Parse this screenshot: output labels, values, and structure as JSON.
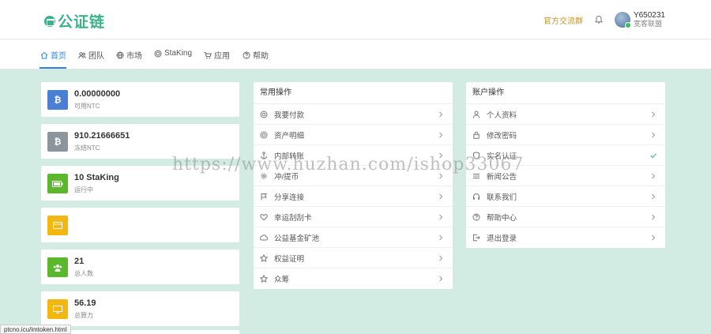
{
  "header": {
    "logo_text": "公证链",
    "community_link": "官方交流群",
    "user_name": "Y650231",
    "user_role": "宽客联盟",
    "brand_color": "#3bb28a"
  },
  "nav": {
    "items": [
      {
        "label": "首页",
        "icon": "home-icon",
        "active": true
      },
      {
        "label": "团队",
        "icon": "users-icon",
        "active": false
      },
      {
        "label": "市场",
        "icon": "globe-icon",
        "active": false
      },
      {
        "label": "StaKing",
        "icon": "coin-icon",
        "active": false
      },
      {
        "label": "应用",
        "icon": "cart-icon",
        "active": false
      },
      {
        "label": "帮助",
        "icon": "help-icon",
        "active": false
      }
    ]
  },
  "stats": [
    {
      "value": "0.00000000",
      "label": "可用NTC",
      "color": "#4a7fd4",
      "icon": "bitcoin-icon",
      "glyph": "₿"
    },
    {
      "value": "910.21666651",
      "label": "冻结NTC",
      "color": "#8d959c",
      "icon": "bitcoin-icon",
      "glyph": "₿"
    },
    {
      "value": "10 StaKing",
      "label": "运行中",
      "color": "#5bb82c",
      "icon": "battery-icon",
      "glyph": ""
    },
    {
      "value": "",
      "label": "",
      "color": "#f2b710",
      "icon": "card-icon",
      "glyph": ""
    },
    {
      "value": "21",
      "label": "总人数",
      "color": "#5bb82c",
      "icon": "group-icon",
      "glyph": ""
    },
    {
      "value": "56.19",
      "label": "总算力",
      "color": "#f2b710",
      "icon": "monitor-icon",
      "glyph": ""
    }
  ],
  "common_ops": {
    "title": "常用操作",
    "items": [
      {
        "label": "我要付款",
        "icon": "coin-icon"
      },
      {
        "label": "资产明细",
        "icon": "coin-icon"
      },
      {
        "label": "内部转账",
        "icon": "anchor-icon"
      },
      {
        "label": "冲/提币",
        "icon": "gear-icon"
      },
      {
        "label": "分享连接",
        "icon": "flag-icon"
      },
      {
        "label": "幸运刮刮卡",
        "icon": "heart-icon"
      },
      {
        "label": "公益基金矿池",
        "icon": "cloud-icon"
      },
      {
        "label": "权益证明",
        "icon": "star-icon"
      },
      {
        "label": "众筹",
        "icon": "star-icon"
      }
    ]
  },
  "account_ops": {
    "title": "账户操作",
    "items": [
      {
        "label": "个人资料",
        "icon": "user-icon",
        "mark": "chevron"
      },
      {
        "label": "修改密码",
        "icon": "lock-icon",
        "mark": "chevron"
      },
      {
        "label": "实名认证",
        "icon": "shield-icon",
        "mark": "check"
      },
      {
        "label": "新闻公告",
        "icon": "list-icon",
        "mark": "chevron"
      },
      {
        "label": "联系我们",
        "icon": "headset-icon",
        "mark": "chevron"
      },
      {
        "label": "帮助中心",
        "icon": "help-icon",
        "mark": "chevron"
      },
      {
        "label": "退出登录",
        "icon": "logout-icon",
        "mark": "chevron"
      }
    ]
  },
  "watermark": "https://www.huzhan.com/ishop33067",
  "status_url": "ptcno.icu/imtoken.html"
}
